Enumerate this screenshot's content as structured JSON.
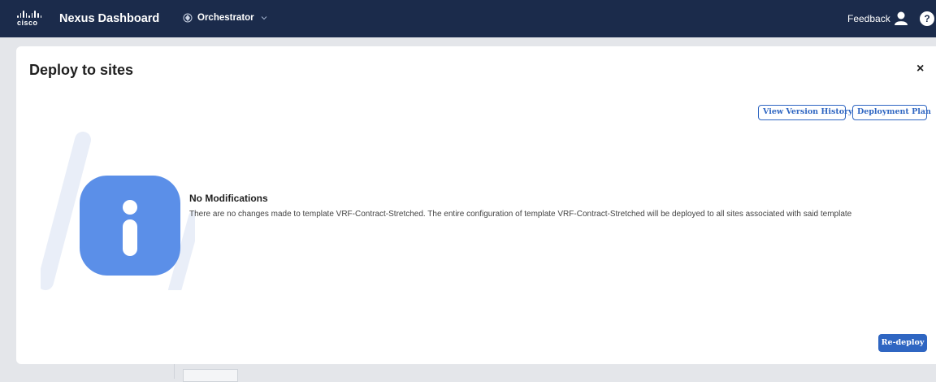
{
  "header": {
    "brand": "cisco",
    "app_title": "Nexus Dashboard",
    "service": "Orchestrator",
    "feedback": "Feedback",
    "help": "?"
  },
  "modal": {
    "title": "Deploy to sites",
    "close": "×",
    "buttons": {
      "view_version_history": "View Version History",
      "deployment_plan": "Deployment Plan",
      "redeploy": "Re-deploy"
    },
    "message": {
      "title": "No Modifications",
      "text": "There are no changes made to template VRF-Contract-Stretched. The entire configuration of template VRF-Contract-Stretched will be deployed to all sites associated with said template"
    }
  },
  "colors": {
    "header_bg": "#1b2b4b",
    "accent": "#2f66c2",
    "info_icon": "#5b8fe8"
  },
  "icons": [
    "cisco-logo",
    "orchestrator-icon",
    "chevron-down-icon",
    "user-icon",
    "help-icon",
    "close-icon",
    "info-icon"
  ]
}
